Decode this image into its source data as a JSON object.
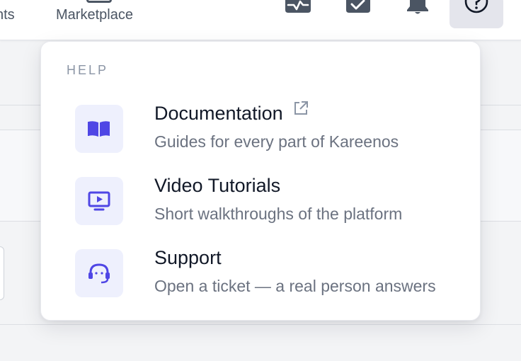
{
  "nav": {
    "tabs": [
      {
        "label": "nts"
      },
      {
        "label": "Marketplace"
      }
    ],
    "icons": [
      "activity-icon",
      "checkbox-icon",
      "bell-icon",
      "help-circle-icon"
    ]
  },
  "help_menu": {
    "heading": "HELP",
    "items": [
      {
        "title": "Documentation",
        "description": "Guides for every part of Kareenos",
        "icon": "book-open-icon",
        "external": true
      },
      {
        "title": "Video Tutorials",
        "description": "Short walkthroughs of the platform",
        "icon": "video-play-icon",
        "external": false
      },
      {
        "title": "Support",
        "description": "Open a ticket — a real person answers",
        "icon": "headset-icon",
        "external": false
      }
    ]
  },
  "colors": {
    "accent": "#4f46e5",
    "icon_tile": "#eef0fd",
    "active_button": "#e4e5ec",
    "nav_icon": "#4b5563"
  }
}
